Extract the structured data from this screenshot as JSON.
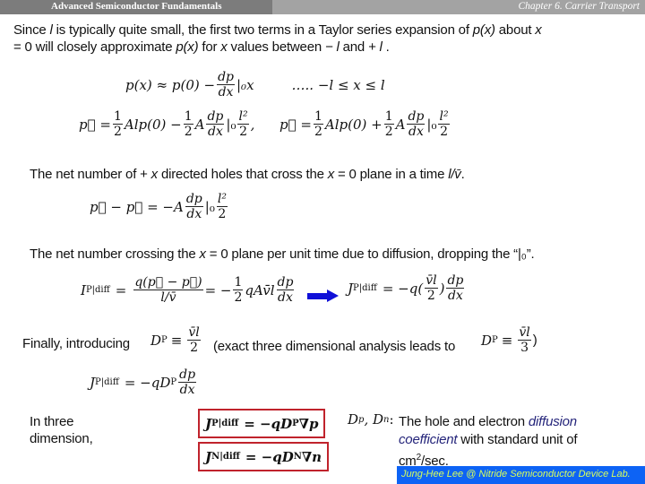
{
  "header": {
    "title": "Advanced Semiconductor Fundamentals",
    "chapter": "Chapter 6. Carrier Transport",
    "colors": {
      "left_bar": "#7c7c7c",
      "right_bar": "#a3a3a3"
    }
  },
  "intro": {
    "line1_a": "Since ",
    "l": "l",
    "line1_b": " is typically quite small, the first two terms in a Taylor series expansion of ",
    "px": "p(x)",
    "line1_c": " about ",
    "x": "x",
    "line2_a": "= 0 will closely approximate ",
    "line2_b": " for ",
    "line2_c": " values between ",
    "minus_l": "− l",
    "and": " and ",
    "plus_l": "+ l",
    "dot": " ."
  },
  "equations": {
    "taylor": {
      "lhs": "p(x) ≈ p(0) −",
      "num": "dp",
      "den": "dx",
      "tail": "|₀x",
      "range": "….. −l ≤ x ≤ l"
    },
    "p_right": {
      "lhs": "p⃗ =",
      "t1_num": "1",
      "t1_den": "2",
      "t1": "Alp(0) −",
      "t2_num": "1",
      "t2_den": "2",
      "t2": "A",
      "d_num": "dp",
      "d_den": "dx",
      "bar": "|₀",
      "l_num": "l²",
      "l_den": "2",
      "comma": ","
    },
    "p_left": {
      "lhs": "p⃖ =",
      "t1_num": "1",
      "t1_den": "2",
      "t1": "Alp(0) +",
      "t2_num": "1",
      "t2_den": "2",
      "t2": "A",
      "d_num": "dp",
      "d_den": "dx",
      "bar": "|₀",
      "l_num": "l²",
      "l_den": "2"
    },
    "net_text": {
      "a": "The net number of + ",
      "x": "x",
      "b": " directed holes that cross the ",
      "x0": "x",
      "c": " = 0 plane in a time ",
      "t": "l/v̄",
      "d": "."
    },
    "difference": {
      "lhs": "p⃗ − p⃖ = −A",
      "d_num": "dp",
      "d_den": "dx",
      "bar": "|₀",
      "l_num": "l²",
      "l_den": "2"
    },
    "diff_text": {
      "a": "The net number crossing the ",
      "x": "x",
      "b": " = 0 plane per unit time due to diffusion, dropping the “|₀”."
    },
    "current": {
      "lhs": "I",
      "lhs_sub": "P|diff",
      "eq": "=",
      "f_num": "q(p⃗ − p⃖)",
      "f_den": "l/v̄",
      "eq2": "= −",
      "h_num": "1",
      "h_den": "2",
      "mid": "qAv̄l",
      "d_num": "dp",
      "d_den": "dx"
    },
    "current_j": {
      "lhs": "J",
      "lhs_sub": "P|diff",
      "rhs": "= −q(",
      "v_num": "v̄l",
      "v_den": "2",
      "close": ")",
      "d_num": "dp",
      "d_den": "dx"
    },
    "finally": {
      "text": "Finally, introducing",
      "dp": "D",
      "dp_sub": "P",
      "eq": "≡",
      "num": "v̄l",
      "den": "2",
      "paren": "(exact three dimensional analysis leads to",
      "dp2": "D",
      "dp2_sub": "P",
      "eq2": "≡",
      "num2": "v̄l",
      "den2": "3",
      "close": ")"
    },
    "j_final": {
      "lhs": "J",
      "lhs_sub": "P|diff",
      "rhs": "= −qD",
      "rhs_sub": "P",
      "d_num": "dp",
      "d_den": "dx"
    },
    "three_dim": {
      "label": "In three dimension,",
      "jp": "J",
      "jp_sub": "P|diff",
      "jp_rhs": "= −qD",
      "jp_rhs_sub": "P",
      "jp_tail": "∇p",
      "jn": "J",
      "jn_sub": "N|diff",
      "jn_rhs": "= −qD",
      "jn_rhs_sub": "N",
      "jn_tail": "∇n",
      "box_color": "#c0232c"
    },
    "definition": {
      "sym": "D",
      "sym_p": "p",
      "sep": ", D",
      "sym_n": "n",
      "colon": ":",
      "a": "The hole and electron ",
      "b": "diffusion",
      "c": "coefficient",
      "d": " with standard unit of",
      "e": "cm",
      "sup": "2",
      "f": "/sec."
    }
  },
  "footer": {
    "text": "Jung-Hee Lee @ Nitride Semiconductor Device Lab.",
    "bg": "#0d63f5",
    "fg": "#d7ff5c"
  },
  "arrow": {
    "icon": "right-arrow-icon",
    "color": "#1010d8"
  }
}
